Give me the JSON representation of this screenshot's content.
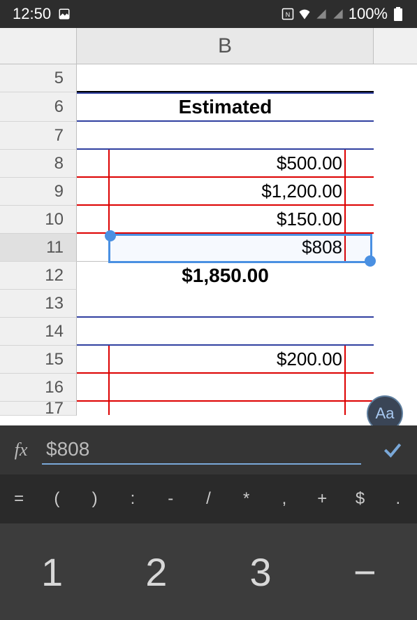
{
  "status": {
    "time": "12:50",
    "battery": "100%"
  },
  "columns": {
    "b": "B"
  },
  "rows": {
    "header": "Estimated",
    "r5": "5",
    "r6": "6",
    "r7": "7",
    "r8": "8",
    "r9": "9",
    "r10": "10",
    "r11": "11",
    "r12": "12",
    "r13": "13",
    "r14": "14",
    "r15": "15",
    "r16": "16",
    "r17": "17"
  },
  "cells": {
    "b6": "Estimated",
    "b8": "$500.00",
    "b9": "$1,200.00",
    "b10": "$150.00",
    "b11": "$808",
    "b12": "$1,850.00",
    "b15": "$200.00"
  },
  "formula": {
    "value": "$808"
  },
  "fab": {
    "label": "Aa"
  },
  "symbols": {
    "eq": "=",
    "lp": "(",
    "rp": ")",
    "colon": ":",
    "minus": "-",
    "slash": "/",
    "star": "*",
    "comma": ",",
    "plus": "+",
    "dollar": "$",
    "dot": "."
  },
  "numpad": {
    "k1": "1",
    "k2": "2",
    "k3": "3",
    "kminus": "−"
  }
}
